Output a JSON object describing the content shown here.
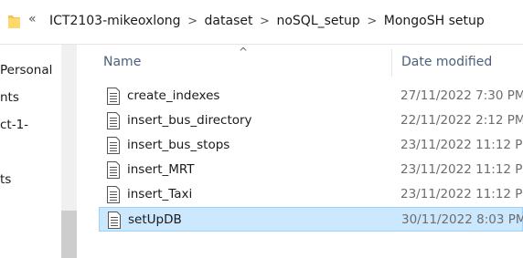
{
  "address_bar": {
    "folder_icon": "folder-icon",
    "overflow_symbol": "«",
    "crumbs": [
      {
        "label": "ICT2103-mikeoxlong"
      },
      {
        "label": "dataset"
      },
      {
        "label": "noSQL_setup"
      },
      {
        "label": "MongoSH setup"
      }
    ],
    "separator": ">"
  },
  "navigation": {
    "items": [
      {
        "label": "Personal"
      },
      {
        "label": "nts"
      },
      {
        "label": "ct-1-"
      },
      {
        "label": "ts"
      }
    ]
  },
  "columns": {
    "sort_indicator": "^",
    "name": "Name",
    "date_modified": "Date modified"
  },
  "files": [
    {
      "name": "create_indexes",
      "date": "27/11/2022 7:30 PM",
      "icon": "text-file-icon",
      "selected": false
    },
    {
      "name": "insert_bus_directory",
      "date": "22/11/2022 2:12 PM",
      "icon": "text-file-icon",
      "selected": false
    },
    {
      "name": "insert_bus_stops",
      "date": "23/11/2022 11:12 PM",
      "icon": "text-file-icon",
      "selected": false
    },
    {
      "name": "insert_MRT",
      "date": "23/11/2022 11:12 PM",
      "icon": "text-file-icon",
      "selected": false
    },
    {
      "name": "insert_Taxi",
      "date": "23/11/2022 11:12 PM",
      "icon": "text-file-icon",
      "selected": false
    },
    {
      "name": "setUpDB",
      "date": "30/11/2022 8:03 PM",
      "icon": "text-file-icon",
      "selected": true
    }
  ],
  "colors": {
    "selection_bg": "#cce8ff",
    "selection_border": "#99d1ff",
    "header_text": "#4c607a",
    "date_text": "#6d6d6d"
  }
}
